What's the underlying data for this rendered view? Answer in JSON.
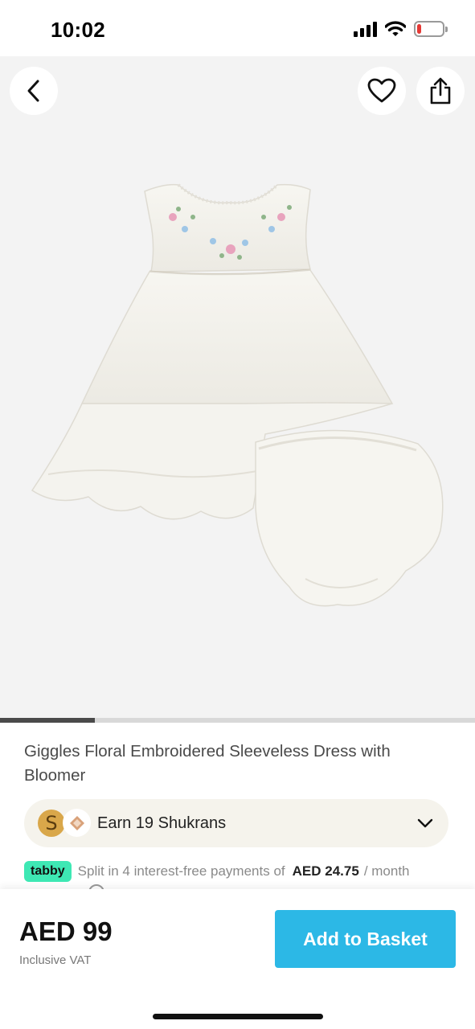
{
  "status_bar": {
    "time": "10:02",
    "battery_level": 0.15,
    "icons": [
      "signal-icon",
      "wifi-icon",
      "battery-icon"
    ]
  },
  "gallery": {
    "buttons": {
      "back": "chevron-left-icon",
      "favorite": "heart-icon",
      "share": "share-icon"
    },
    "image_progress": 0.2
  },
  "product": {
    "title": "Giggles Floral Embroidered Sleeveless Dress with Bloomer"
  },
  "shukran": {
    "label": "Earn 19 Shukrans",
    "coin_letter": "S"
  },
  "tabby": {
    "badge": "tabby",
    "text": "Split in 4 interest-free payments of",
    "amount": "AED 24.75",
    "suffix": "/ month"
  },
  "bottom_bar": {
    "price": "AED 99",
    "vat": "Inclusive VAT",
    "add_to_basket": "Add to Basket"
  },
  "colors": {
    "accent": "#2cb8e6",
    "tabby": "#3ee8b4",
    "battery_low": "#e53935"
  }
}
